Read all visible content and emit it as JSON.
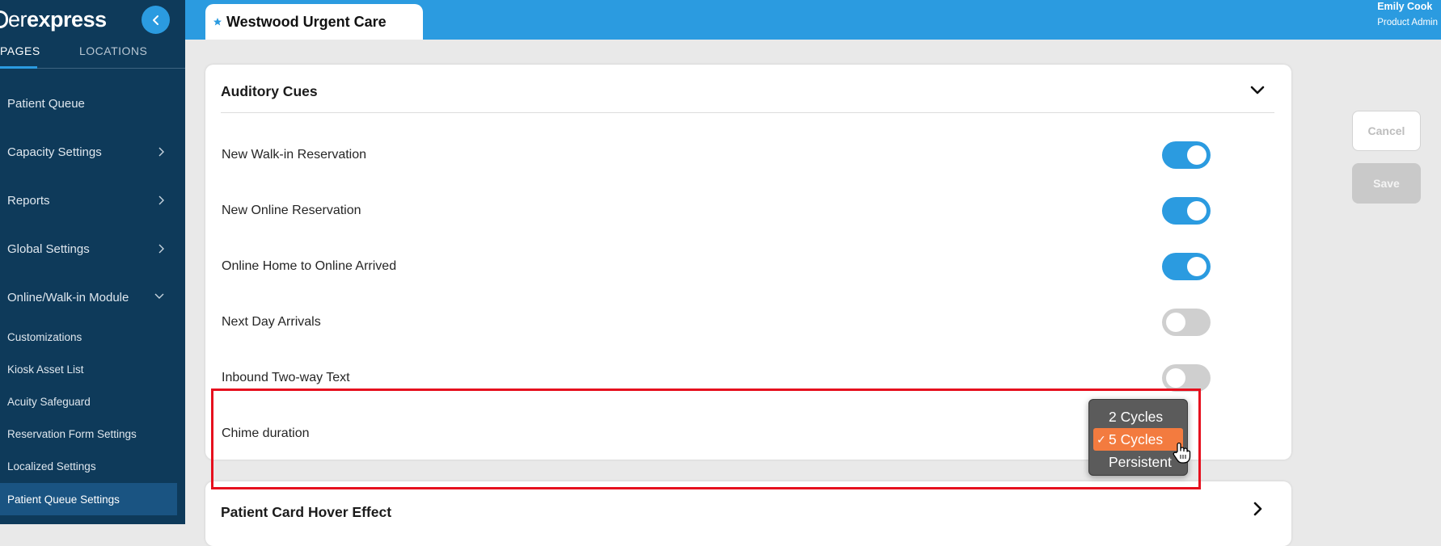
{
  "brand": {
    "light": "er",
    "bold": "express"
  },
  "nav": {
    "tabs": [
      {
        "label": "PAGES",
        "active": true
      },
      {
        "label": "LOCATIONS",
        "active": false
      }
    ],
    "items": [
      {
        "label": "Patient Queue"
      },
      {
        "label": "Capacity Settings"
      },
      {
        "label": "Reports"
      },
      {
        "label": "Global Settings"
      },
      {
        "label": "Online/Walk-in Module"
      }
    ],
    "subitems": [
      {
        "label": "Customizations"
      },
      {
        "label": "Kiosk Asset List"
      },
      {
        "label": "Acuity Safeguard"
      },
      {
        "label": "Reservation Form Settings"
      },
      {
        "label": "Localized Settings"
      },
      {
        "label": "Patient Queue Settings",
        "active": true
      }
    ]
  },
  "header": {
    "location_name": "Westwood Urgent Care",
    "user_name": "Emily Cook",
    "user_role": "Product Admin"
  },
  "auditory_cues": {
    "title": "Auditory Cues",
    "settings": [
      {
        "label": "New Walk-in Reservation",
        "enabled": true
      },
      {
        "label": "New Online Reservation",
        "enabled": true
      },
      {
        "label": "Online Home to Online Arrived",
        "enabled": true
      },
      {
        "label": "Next Day Arrivals",
        "enabled": false
      },
      {
        "label": "Inbound Two-way Text",
        "enabled": false
      }
    ],
    "chime_label": "Chime duration",
    "chime_options": [
      "2 Cycles",
      "5 Cycles",
      "Persistent"
    ],
    "chime_selected": "5 Cycles",
    "check_glyph": "✓"
  },
  "hover_section": {
    "title": "Patient Card Hover Effect"
  },
  "actions": {
    "cancel_label": "Cancel",
    "save_label": "Save"
  },
  "colors": {
    "sidebar_bg": "#0e3a5a",
    "accent_blue": "#2b9be0",
    "selected_option": "#f37b3f",
    "highlight_red": "#e6101e"
  }
}
